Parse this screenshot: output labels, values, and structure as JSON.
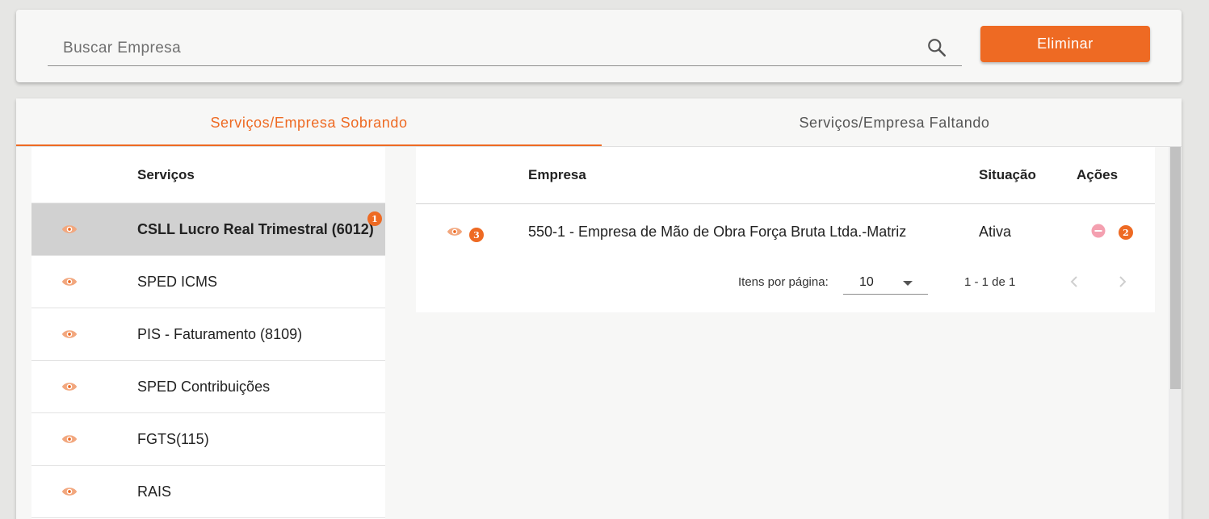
{
  "search": {
    "placeholder": "Buscar Empresa",
    "value": ""
  },
  "toolbar": {
    "eliminar_label": "Eliminar"
  },
  "tabs": [
    {
      "label": "Serviços/Empresa Sobrando",
      "active": true
    },
    {
      "label": "Serviços/Empresa Faltando",
      "active": false
    }
  ],
  "services": {
    "header": "Serviços",
    "items": [
      {
        "label": "CSLL Lucro Real Trimestral (6012)",
        "selected": true
      },
      {
        "label": "SPED ICMS",
        "selected": false
      },
      {
        "label": "PIS - Faturamento (8109)",
        "selected": false
      },
      {
        "label": "SPED Contribuições",
        "selected": false
      },
      {
        "label": "FGTS(115)",
        "selected": false
      },
      {
        "label": "RAIS",
        "selected": false
      }
    ],
    "badge": "1"
  },
  "companies": {
    "headers": {
      "empresa": "Empresa",
      "situacao": "Situação",
      "acoes": "Ações"
    },
    "rows": [
      {
        "empresa": "550-1 - Empresa de Mão de Obra Força Bruta Ltda.-Matriz",
        "situacao": "Ativa",
        "view_badge": "3",
        "action_badge": "2"
      }
    ]
  },
  "paginator": {
    "items_per_page_label": "Itens por página:",
    "page_size": "10",
    "range_label": "1 - 1 de 1"
  },
  "colors": {
    "accent": "#ee6a23",
    "eye_icon": "#f2a77e",
    "remove_icon": "#f4a0b0",
    "selected_row": "#d1d1d1"
  }
}
